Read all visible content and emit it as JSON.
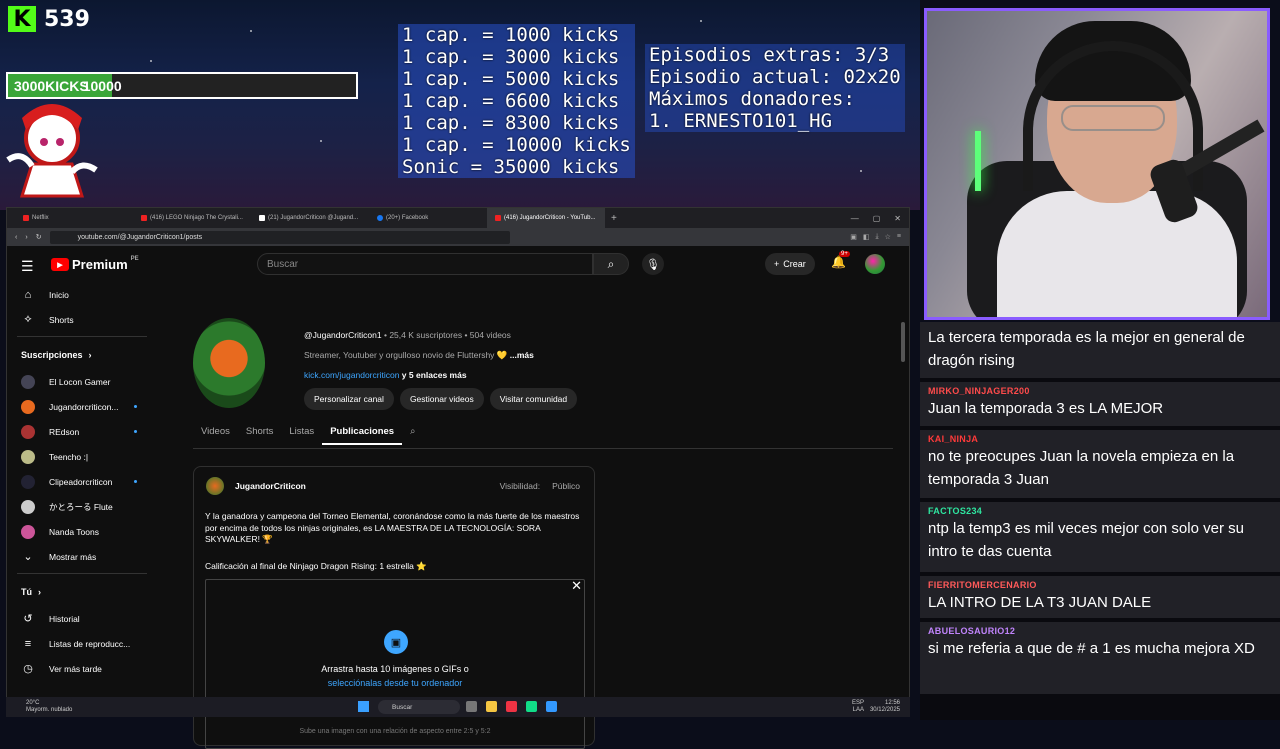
{
  "overlay": {
    "kick_count": "539",
    "goal": {
      "start": "3000",
      "title": "KICKS",
      "end": "10000",
      "progress": 0.3
    },
    "kicks_list": [
      "1 cap. = 1000 kicks",
      "1 cap. = 3000 kicks",
      "1 cap. = 5000 kicks",
      "1 cap. = 6600 kicks",
      "1 cap. = 8300 kicks",
      "1 cap. = 10000 kicks",
      "Sonic = 35000 kicks"
    ],
    "episodes": [
      "Episodios extras: 3/3",
      "Episodio actual: 02x20",
      "Máximos donadores:",
      "1. ERNESTO101_HG"
    ]
  },
  "browser": {
    "tabs": [
      "Netflix",
      "(416) LEGO Ninjago The Crystali...",
      "(21) JugandorCriticon @Jugand...",
      "(20+) Facebook",
      "(416) JugandorCriticon - YouTub..."
    ],
    "url": "youtube.com/@JugandorCriticon1/posts"
  },
  "youtube": {
    "logo": "Premium",
    "logo_region": "PE",
    "search_placeholder": "Buscar",
    "create_label": "Crear",
    "notif_badge": "9+",
    "sidebar": {
      "main": [
        "Inicio",
        "Shorts"
      ],
      "subs_header": "Suscripciones",
      "subs": [
        "El Locon Gamer",
        "Jugandorcriticon...",
        "REdson",
        "Teencho :|",
        "Clipeadorcriticon",
        "かとろーる Flute",
        "Nanda Toons",
        "Mostrar más"
      ],
      "you_header": "Tú",
      "you": [
        "Historial",
        "Listas de reproducc...",
        "Ver más tarde"
      ]
    },
    "channel": {
      "handle": "@JugandorCriticon1",
      "stats": " • 25,4 K suscriptores • 504 videos",
      "description": "Streamer, Youtuber y orgulloso novio de Fluttershy 💛 ",
      "more": "...más",
      "link": "kick.com/jugandorcriticon",
      "link_more": " y 5 enlaces más",
      "buttons": [
        "Personalizar canal",
        "Gestionar videos",
        "Visitar comunidad"
      ],
      "tabs": [
        "Videos",
        "Shorts",
        "Listas",
        "Publicaciones"
      ]
    },
    "post": {
      "author": "JugandorCriticon",
      "visibility_label": "Visibilidad:",
      "visibility": "Público",
      "text": "Y la ganadora y campeona del Torneo Elemental, coronándose como la más fuerte de los maestros por encima de todos los ninjas originales, es LA MAESTRA DE LA TECNOLOGÍA: SORA SKYWALKER! 🏆",
      "rating": "Calificación al final de Ninjago Dragon Rising: 1 estrella ⭐",
      "upload_text": "Arrastra hasta 10 imágenes o GIFs o",
      "upload_link": "selecciónalas desde tu ordenador",
      "upload_hint": "Sube una imagen con una relación de aspecto entre 2:5 y 5:2"
    }
  },
  "taskbar": {
    "weather_temp": "20°C",
    "weather_desc": "Mayorm. nublado",
    "search": "Buscar",
    "lang": "ESP",
    "lang2": "LAA",
    "time": "12:56",
    "date": "30/12/2025"
  },
  "chat": [
    {
      "user": "",
      "color": "#ffffff",
      "text": "La tercera temporada es la mejor en general de dragón rising"
    },
    {
      "user": "MIRKO_NINJAGER200",
      "color": "#ff4b4b",
      "text": "Juan la temporada 3 es LA MEJOR"
    },
    {
      "user": "KAI_NINJA",
      "color": "#ff3a3a",
      "text": "no te preocupes Juan la novela empieza en la temporada 3 Juan"
    },
    {
      "user": "FACTOS234",
      "color": "#2ee6a0",
      "text": "ntp la temp3 es mil veces mejor con solo ver su intro te das cuenta"
    },
    {
      "user": "FIERRITOMERCENARIO",
      "color": "#ff5a5a",
      "text": "LA INTRO DE LA T3 JUAN DALE"
    },
    {
      "user": "ABUELOSAURIO12",
      "color": "#c084fc",
      "text": "si me referia a que de # a 1 es mucha mejora XD"
    }
  ]
}
